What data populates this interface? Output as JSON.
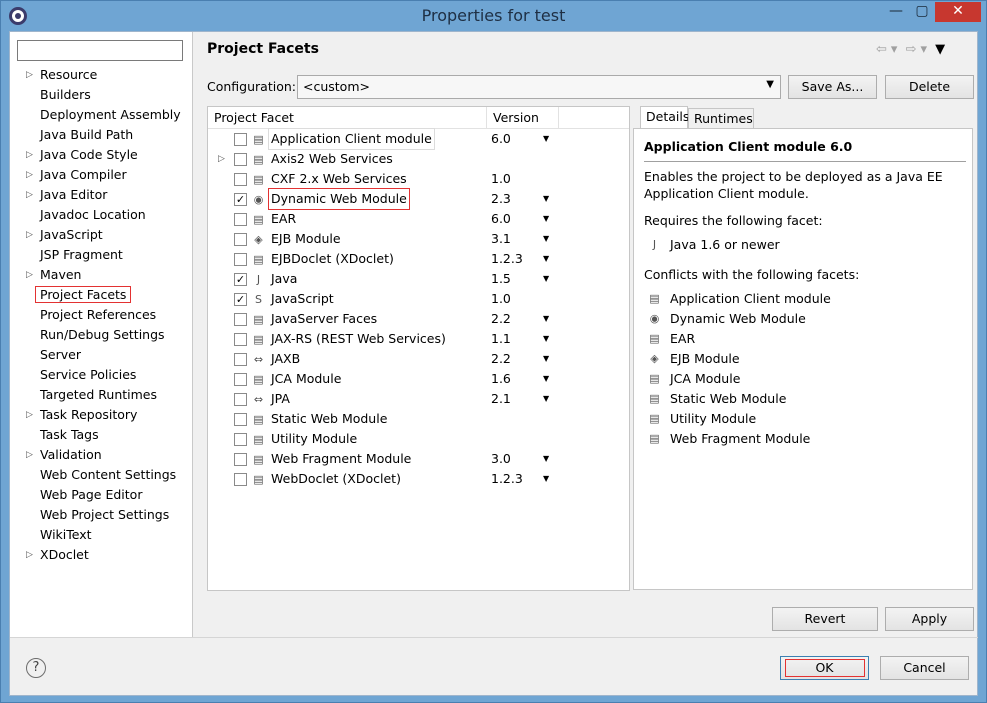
{
  "window": {
    "title": "Properties for test",
    "minimize_glyph": "—",
    "maximize_glyph": "▢",
    "close_glyph": "✕"
  },
  "left": {
    "filter_value": "",
    "items": [
      {
        "label": "Resource",
        "expandable": true
      },
      {
        "label": "Builders",
        "expandable": false
      },
      {
        "label": "Deployment Assembly",
        "expandable": false
      },
      {
        "label": "Java Build Path",
        "expandable": false
      },
      {
        "label": "Java Code Style",
        "expandable": true
      },
      {
        "label": "Java Compiler",
        "expandable": true
      },
      {
        "label": "Java Editor",
        "expandable": true
      },
      {
        "label": "Javadoc Location",
        "expandable": false
      },
      {
        "label": "JavaScript",
        "expandable": true
      },
      {
        "label": "JSP Fragment",
        "expandable": false
      },
      {
        "label": "Maven",
        "expandable": true
      },
      {
        "label": "Project Facets",
        "expandable": false,
        "selected": true
      },
      {
        "label": "Project References",
        "expandable": false
      },
      {
        "label": "Run/Debug Settings",
        "expandable": false
      },
      {
        "label": "Server",
        "expandable": false
      },
      {
        "label": "Service Policies",
        "expandable": false
      },
      {
        "label": "Targeted Runtimes",
        "expandable": false
      },
      {
        "label": "Task Repository",
        "expandable": true
      },
      {
        "label": "Task Tags",
        "expandable": false
      },
      {
        "label": "Validation",
        "expandable": true
      },
      {
        "label": "Web Content Settings",
        "expandable": false
      },
      {
        "label": "Web Page Editor",
        "expandable": false
      },
      {
        "label": "Web Project Settings",
        "expandable": false
      },
      {
        "label": "WikiText",
        "expandable": false
      },
      {
        "label": "XDoclet",
        "expandable": true
      }
    ]
  },
  "main": {
    "title": "Project Facets",
    "nav": {
      "back": "⇦",
      "back_menu": "▾",
      "forward": "⇨",
      "forward_menu": "▾",
      "view_menu": "▼"
    },
    "configuration_label": "Configuration:",
    "configuration_value": "<custom>",
    "save_as_label": "Save As...",
    "delete_label": "Delete",
    "table": {
      "col_facet": "Project Facet",
      "col_version": "Version",
      "rows": [
        {
          "name": "Application Client module",
          "version": "6.0",
          "checked": false,
          "dropdown": true,
          "expand": false,
          "icon": "page-icon",
          "boxed": true
        },
        {
          "name": "Axis2 Web Services",
          "version": "",
          "checked": false,
          "dropdown": false,
          "expand": true,
          "icon": "page-icon"
        },
        {
          "name": "CXF 2.x Web Services",
          "version": "1.0",
          "checked": false,
          "dropdown": false,
          "expand": false,
          "icon": "page-icon"
        },
        {
          "name": "Dynamic Web Module",
          "version": "2.3",
          "checked": true,
          "dropdown": true,
          "expand": false,
          "icon": "globe-icon",
          "highlight": true
        },
        {
          "name": "EAR",
          "version": "6.0",
          "checked": false,
          "dropdown": true,
          "expand": false,
          "icon": "page-icon"
        },
        {
          "name": "EJB Module",
          "version": "3.1",
          "checked": false,
          "dropdown": true,
          "expand": false,
          "icon": "bean-icon"
        },
        {
          "name": "EJBDoclet (XDoclet)",
          "version": "1.2.3",
          "checked": false,
          "dropdown": true,
          "expand": false,
          "icon": "page-icon"
        },
        {
          "name": "Java",
          "version": "1.5",
          "checked": true,
          "dropdown": true,
          "expand": false,
          "icon": "java-icon"
        },
        {
          "name": "JavaScript",
          "version": "1.0",
          "checked": true,
          "dropdown": false,
          "expand": false,
          "icon": "js-icon"
        },
        {
          "name": "JavaServer Faces",
          "version": "2.2",
          "checked": false,
          "dropdown": true,
          "expand": false,
          "icon": "page-icon"
        },
        {
          "name": "JAX-RS (REST Web Services)",
          "version": "1.1",
          "checked": false,
          "dropdown": true,
          "expand": false,
          "icon": "page-icon"
        },
        {
          "name": "JAXB",
          "version": "2.2",
          "checked": false,
          "dropdown": true,
          "expand": false,
          "icon": "arrows-icon"
        },
        {
          "name": "JCA Module",
          "version": "1.6",
          "checked": false,
          "dropdown": true,
          "expand": false,
          "icon": "page-icon"
        },
        {
          "name": "JPA",
          "version": "2.1",
          "checked": false,
          "dropdown": true,
          "expand": false,
          "icon": "arrows-icon"
        },
        {
          "name": "Static Web Module",
          "version": "",
          "checked": false,
          "dropdown": false,
          "expand": false,
          "icon": "page-icon"
        },
        {
          "name": "Utility Module",
          "version": "",
          "checked": false,
          "dropdown": false,
          "expand": false,
          "icon": "page-icon"
        },
        {
          "name": "Web Fragment Module",
          "version": "3.0",
          "checked": false,
          "dropdown": true,
          "expand": false,
          "icon": "page-icon"
        },
        {
          "name": "WebDoclet (XDoclet)",
          "version": "1.2.3",
          "checked": false,
          "dropdown": true,
          "expand": false,
          "icon": "page-icon"
        }
      ]
    },
    "tabs": {
      "details": "Details",
      "runtimes": "Runtimes"
    },
    "details": {
      "title": "Application Client module 6.0",
      "description": "Enables the project to be deployed as a Java EE Application Client module.",
      "requires_label": "Requires the following facet:",
      "requires": [
        {
          "label": "Java 1.6 or newer",
          "icon": "java-icon"
        }
      ],
      "conflicts_label": "Conflicts with the following facets:",
      "conflicts": [
        {
          "label": "Application Client module",
          "icon": "page-icon"
        },
        {
          "label": "Dynamic Web Module",
          "icon": "globe-icon"
        },
        {
          "label": "EAR",
          "icon": "page-icon"
        },
        {
          "label": "EJB Module",
          "icon": "bean-icon"
        },
        {
          "label": "JCA Module",
          "icon": "page-icon"
        },
        {
          "label": "Static Web Module",
          "icon": "page-icon"
        },
        {
          "label": "Utility Module",
          "icon": "page-icon"
        },
        {
          "label": "Web Fragment Module",
          "icon": "page-icon"
        }
      ]
    },
    "revert_label": "Revert",
    "apply_label": "Apply"
  },
  "footer": {
    "help_glyph": "?",
    "ok_label": "OK",
    "cancel_label": "Cancel"
  },
  "icon_glyphs": {
    "page-icon": "▤",
    "globe-icon": "◉",
    "bean-icon": "◈",
    "java-icon": "J",
    "js-icon": "S",
    "arrows-icon": "⇔"
  }
}
